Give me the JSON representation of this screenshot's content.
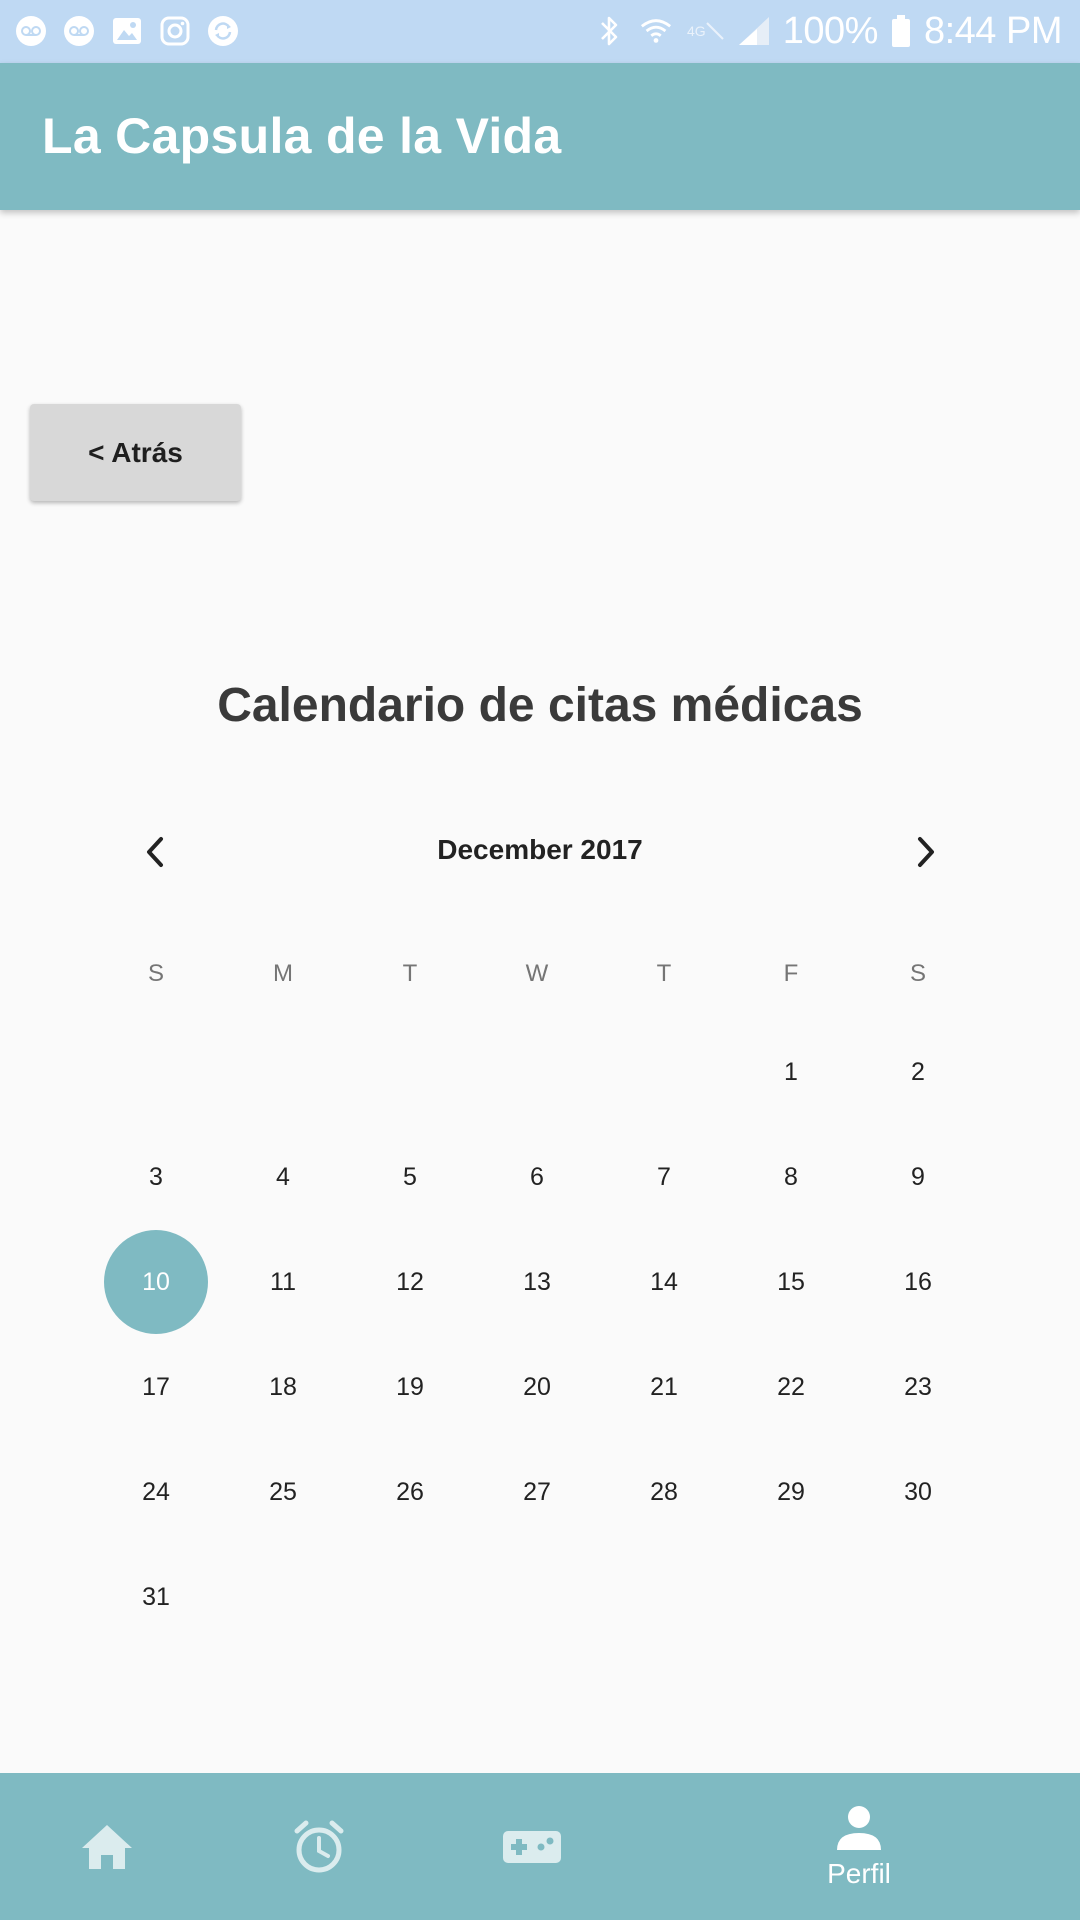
{
  "status_bar": {
    "battery": "100%",
    "time": "8:44 PM",
    "left_icons": [
      "voicemail-icon",
      "voicemail-icon",
      "gallery-icon",
      "instagram-icon",
      "sync-icon"
    ],
    "right_icons": [
      "bluetooth-icon",
      "wifi-icon",
      "lte-icon",
      "signal-icon",
      "battery-icon"
    ]
  },
  "app_bar": {
    "title": "La Capsula de la Vida"
  },
  "back_button": {
    "label": "< Atrás"
  },
  "heading": "Calendario de citas médicas",
  "calendar": {
    "month_label": "December 2017",
    "weekdays": [
      "S",
      "M",
      "T",
      "W",
      "T",
      "F",
      "S"
    ],
    "first_weekday_index": 5,
    "days_in_month": 31,
    "selected_day": 10,
    "selected_color": "#7fbac2"
  },
  "bottom_nav": {
    "items": [
      {
        "icon": "home-icon",
        "label": ""
      },
      {
        "icon": "alarm-icon",
        "label": ""
      },
      {
        "icon": "gamepad-icon",
        "label": ""
      },
      {
        "icon": "person-icon",
        "label": "Perfil"
      }
    ]
  },
  "colors": {
    "accent": "#7fbac2",
    "status_bar": "#bfd9f3",
    "background": "#fafafa"
  }
}
